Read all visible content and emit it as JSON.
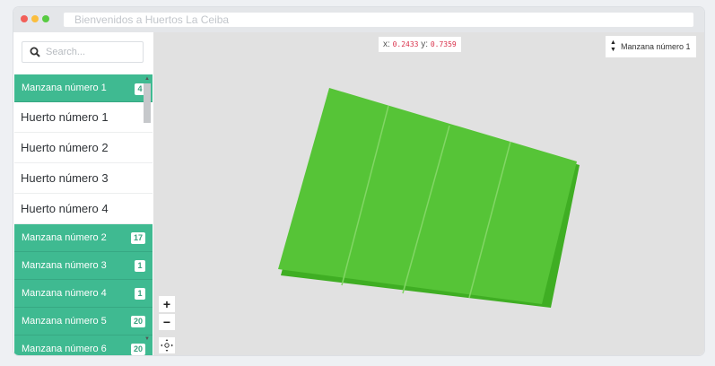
{
  "window": {
    "title": "Bienvenidos a Huertos La Ceiba",
    "dots": {
      "close": "#f25f58",
      "minimize": "#fbbe3e",
      "maximize": "#58cb42"
    }
  },
  "sidebar": {
    "search_placeholder": "Search...",
    "blocks": [
      {
        "label": "Manzana número 1",
        "count": "4",
        "expanded": true,
        "huertos": [
          "Huerto número 1",
          "Huerto número 2",
          "Huerto número 3",
          "Huerto número 4"
        ]
      },
      {
        "label": "Manzana número 2",
        "count": "17"
      },
      {
        "label": "Manzana número 3",
        "count": "1"
      },
      {
        "label": "Manzana número 4",
        "count": "1"
      },
      {
        "label": "Manzana número 5",
        "count": "20"
      },
      {
        "label": "Manzana número 6",
        "count": "20"
      }
    ]
  },
  "map": {
    "coords": {
      "x_label": "x:",
      "x_value": "0.2433",
      "y_label": "y:",
      "y_value": "0.7359"
    },
    "selected_block": "Manzana número 1",
    "zoom_in": "+",
    "zoom_out": "−",
    "colors": {
      "plot_fill": "#56c437",
      "plot_side": "#3fae23",
      "plot_divider": "#82d665",
      "map_bg": "#e1e1e1"
    }
  }
}
